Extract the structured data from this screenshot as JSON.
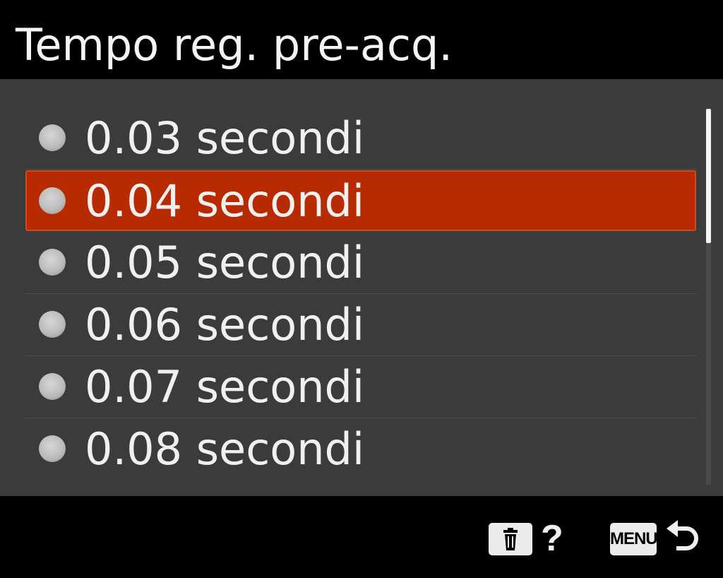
{
  "title": "Tempo reg. pre-acq.",
  "options": [
    {
      "label": "0.03 secondi",
      "selected": false
    },
    {
      "label": "0.04 secondi",
      "selected": true
    },
    {
      "label": "0.05 secondi",
      "selected": false
    },
    {
      "label": "0.06 secondi",
      "selected": false
    },
    {
      "label": "0.07 secondi",
      "selected": false
    },
    {
      "label": "0.08 secondi",
      "selected": false
    }
  ],
  "footer": {
    "help_label": "?",
    "menu_label": "MENU",
    "icons": [
      "trash-icon",
      "help-icon",
      "menu-key-icon",
      "back-arrow-icon"
    ]
  },
  "colors": {
    "selection": "#b82a00",
    "panel": "#3b3b3b",
    "background": "#000000"
  }
}
